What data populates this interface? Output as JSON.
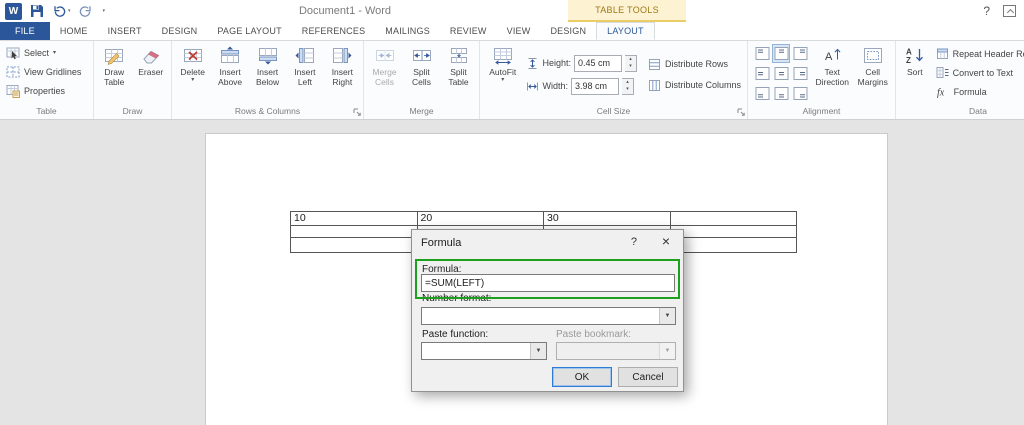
{
  "titlebar": {
    "logo_letter": "W",
    "title": "Document1 - Word",
    "contextual_group": "TABLE TOOLS",
    "help_label": "?"
  },
  "tabs": {
    "file": "FILE",
    "home": "HOME",
    "insert": "INSERT",
    "design": "DESIGN",
    "page_layout": "PAGE LAYOUT",
    "references": "REFERENCES",
    "mailings": "MAILINGS",
    "review": "REVIEW",
    "view": "VIEW",
    "tt_design": "DESIGN",
    "tt_layout": "LAYOUT"
  },
  "ribbon": {
    "table": {
      "label": "Table",
      "select": "Select",
      "view_gridlines": "View Gridlines",
      "properties": "Properties"
    },
    "draw": {
      "label": "Draw",
      "draw_table": "Draw Table",
      "eraser": "Eraser"
    },
    "rows_columns": {
      "label": "Rows & Columns",
      "delete": "Delete",
      "insert_above": "Insert Above",
      "insert_below": "Insert Below",
      "insert_left": "Insert Left",
      "insert_right": "Insert Right"
    },
    "merge": {
      "label": "Merge",
      "merge_cells": "Merge Cells",
      "split_cells": "Split Cells",
      "split_table": "Split Table"
    },
    "cell_size": {
      "label": "Cell Size",
      "autofit": "AutoFit",
      "height_label": "Height:",
      "height_value": "0.45 cm",
      "width_label": "Width:",
      "width_value": "3.98 cm",
      "distribute_rows": "Distribute Rows",
      "distribute_columns": "Distribute Columns"
    },
    "alignment": {
      "label": "Alignment",
      "text_direction": "Text Direction",
      "cell_margins": "Cell Margins"
    },
    "data": {
      "label": "Data",
      "sort": "Sort",
      "repeat_header_rows": "Repeat Header Rows",
      "convert_to_text": "Convert to Text",
      "formula": "Formula"
    }
  },
  "document": {
    "table_rows": [
      [
        "10",
        "20",
        "30",
        ""
      ],
      [
        "",
        "",
        "",
        ""
      ],
      [
        "",
        "",
        "",
        ""
      ]
    ]
  },
  "dialog": {
    "title": "Formula",
    "help": "?",
    "close": "×",
    "formula_label": "Formula:",
    "formula_value": "=SUM(LEFT)",
    "number_format_label": "Number format:",
    "paste_function_label": "Paste function:",
    "paste_bookmark_label": "Paste bookmark:",
    "ok_label": "OK",
    "cancel_label": "Cancel"
  },
  "colors": {
    "accent_blue": "#2b579a",
    "contextual_yellow": "#fdf2d2",
    "highlight_green": "#1da11d"
  }
}
